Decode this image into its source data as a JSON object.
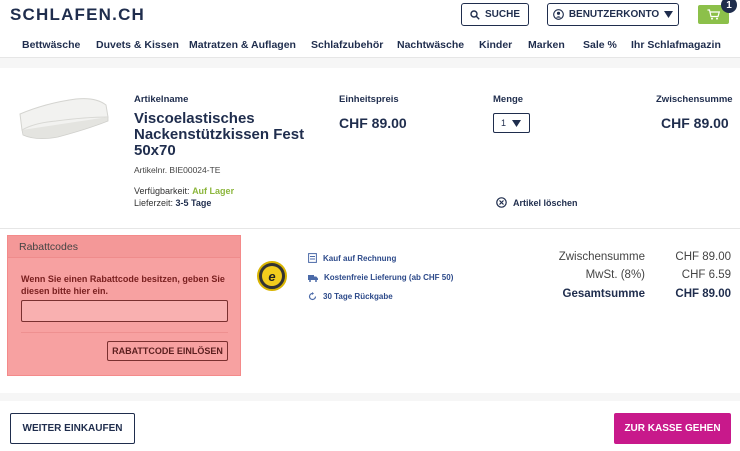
{
  "header": {
    "logo": "SCHLAFEN.CH",
    "search_label": "SUCHE",
    "account_label": "BENUTZERKONTO",
    "cart_count": "1"
  },
  "nav": {
    "items": [
      "Bettwäsche",
      "Duvets & Kissen",
      "Matratzen & Auflagen",
      "Schlafzubehör",
      "Nachtwäsche",
      "Kinder",
      "Marken",
      "Sale %",
      "Ihr Schlafmagazin"
    ]
  },
  "cart": {
    "columns": {
      "name": "Artikelname",
      "unit_price": "Einheitspreis",
      "quantity": "Menge",
      "subtotal": "Zwischensumme"
    },
    "item": {
      "name": "Viscoelastisches Nackenstützkissen Fest 50x70",
      "sku": "Artikelnr. BIE00024-TE",
      "availability_label": "Verfügbarkeit:",
      "availability_value": "Auf Lager",
      "delivery_label": "Lieferzeit:",
      "delivery_value": "3-5 Tage",
      "unit_price": "CHF 89.00",
      "quantity": "1",
      "subtotal": "CHF 89.00",
      "delete_label": "Artikel löschen"
    }
  },
  "coupon": {
    "title": "Rabattcodes",
    "text": "Wenn Sie einen Rabattcode besitzen, geben Sie diesen bitte hier ein.",
    "input_value": "",
    "button_label": "RABATTCODE EINLÖSEN"
  },
  "trust": {
    "features": [
      "Kauf auf Rechnung",
      "Kostenfreie Lieferung (ab CHF 50)",
      "30 Tage Rückgabe"
    ]
  },
  "totals": {
    "subtotal_label": "Zwischensumme",
    "subtotal_value": "CHF 89.00",
    "tax_label": "MwSt. (8%)",
    "tax_value": "CHF 6.59",
    "total_label": "Gesamtsumme",
    "total_value": "CHF 89.00"
  },
  "actions": {
    "continue_label": "WEITER EINKAUFEN",
    "checkout_label": "ZUR KASSE GEHEN"
  },
  "colors": {
    "brand_navy": "#1f2d4d",
    "accent_green": "#8cc04a",
    "checkout_magenta": "#c8198b",
    "coupon_highlight": "#f7a1a1"
  }
}
